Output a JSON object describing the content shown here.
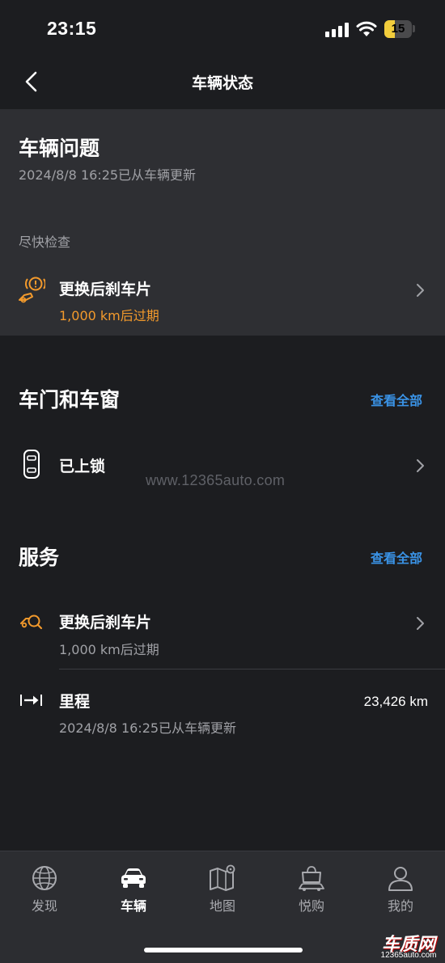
{
  "status_bar": {
    "time": "23:15",
    "battery": "15",
    "battery_level": 0.15,
    "icons": [
      "signal-icon",
      "wifi-icon",
      "battery-icon"
    ]
  },
  "header": {
    "title": "车辆状态",
    "back_icon": "chevron-left-icon"
  },
  "vehicle_issues": {
    "title": "车辆问题",
    "updated": "2024/8/8 16:25已从车辆更新",
    "section_label": "尽快检查",
    "item": {
      "icon": "brake-warning-icon",
      "title": "更换后刹车片",
      "detail": "1,000 km后过期",
      "detail_color": "#f39a2c"
    }
  },
  "doors_windows": {
    "title": "车门和车窗",
    "view_all": "查看全部",
    "item": {
      "icon": "car-lock-icon",
      "title": "已上锁"
    }
  },
  "watermark": "www.12365auto.com",
  "service": {
    "title": "服务",
    "view_all": "查看全部",
    "items": [
      {
        "icon": "brake-service-icon",
        "title": "更换后刹车片",
        "detail": "1,000 km后过期"
      },
      {
        "icon": "odometer-icon",
        "title": "里程",
        "detail": "2024/8/8 16:25已从车辆更新",
        "value": "23,426 km"
      }
    ]
  },
  "bottom_nav": {
    "items": [
      {
        "label": "发现",
        "icon": "globe-icon",
        "active": false
      },
      {
        "label": "车辆",
        "icon": "car-icon",
        "active": true
      },
      {
        "label": "地图",
        "icon": "map-icon",
        "active": false
      },
      {
        "label": "悦购",
        "icon": "shopping-bag-icon",
        "active": false
      },
      {
        "label": "我的",
        "icon": "profile-icon",
        "active": false
      }
    ]
  },
  "brand": {
    "name": "车质网",
    "url": "12365auto.com"
  },
  "colors": {
    "background": "#1c1d20",
    "panel": "#2e2f33",
    "accent_blue": "#3a93e6",
    "warning_orange": "#f39a2c"
  }
}
